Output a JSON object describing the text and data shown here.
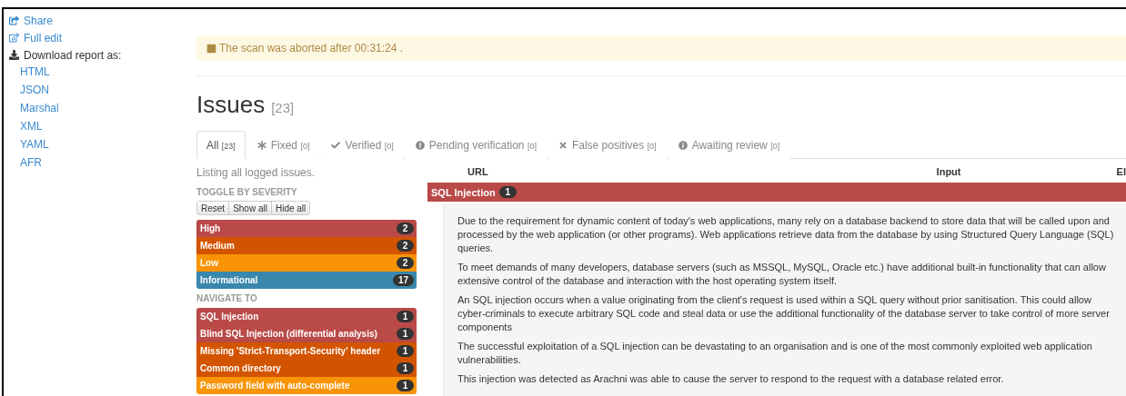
{
  "sidebar": {
    "actions": [
      {
        "label": "Share",
        "kind": "link"
      },
      {
        "label": "Full edit",
        "kind": "link"
      },
      {
        "label": "Download report as:",
        "kind": "label"
      }
    ],
    "formats": [
      "HTML",
      "JSON",
      "Marshal",
      "XML",
      "YAML",
      "AFR"
    ]
  },
  "alert": {
    "text": "The scan was aborted after 00:31:24 ."
  },
  "title": {
    "text": "Issues",
    "count": "[23]"
  },
  "tabs": [
    {
      "label": "All",
      "count": "[23]",
      "selected": true
    },
    {
      "label": "Fixed",
      "count": "[0]",
      "selected": false
    },
    {
      "label": "Verified",
      "count": "[0]",
      "selected": false
    },
    {
      "label": "Pending verification",
      "count": "[0]",
      "selected": false
    },
    {
      "label": "False positives",
      "count": "[0]",
      "selected": false
    },
    {
      "label": "Awaiting review",
      "count": "[0]",
      "selected": false
    }
  ],
  "summary": "Listing all logged issues.",
  "severity_filter": {
    "heading": "TOGGLE BY SEVERITY",
    "buttons": [
      "Reset",
      "Show all",
      "Hide all"
    ],
    "items": [
      {
        "label": "High",
        "count": "2",
        "color": "#b94a48"
      },
      {
        "label": "Medium",
        "count": "2",
        "color": "#d35400"
      },
      {
        "label": "Low",
        "count": "2",
        "color": "#f89406"
      },
      {
        "label": "Informational",
        "count": "17",
        "color": "#3a87ad"
      }
    ]
  },
  "navigate": {
    "heading": "NAVIGATE TO",
    "items": [
      {
        "label": "SQL Injection",
        "count": "1",
        "color": "#b94a48"
      },
      {
        "label": "Blind SQL Injection (differential analysis)",
        "count": "1",
        "color": "#b94a48"
      },
      {
        "label": "Missing 'Strict-Transport-Security' header",
        "count": "1",
        "color": "#d35400"
      },
      {
        "label": "Common directory",
        "count": "1",
        "color": "#d35400"
      },
      {
        "label": "Password field with auto-complete",
        "count": "1",
        "color": "#f89406"
      }
    ]
  },
  "table": {
    "columns": [
      "URL",
      "Input",
      "El"
    ]
  },
  "issue_group": {
    "title": "SQL Injection",
    "count": "1",
    "color": "#b94a48",
    "description": [
      "Due to the requirement for dynamic content of today's web applications, many rely on a database backend to store data that will be called upon and processed by the web application (or other programs). Web applications retrieve data from the database by using Structured Query Language (SQL) queries.",
      "To meet demands of many developers, database servers (such as MSSQL, MySQL, Oracle etc.) have additional built-in functionality that can allow extensive control of the database and interaction with the host operating system itself.",
      "An SQL injection occurs when a value originating from the client's request is used within a SQL query without prior sanitisation. This could allow cyber-criminals to execute arbitrary SQL code and steal data or use the additional functionality of the database server to take control of more server components",
      "The successful exploitation of a SQL injection can be devastating to an organisation and is one of the most commonly exploited web application vulnerabilities.",
      "This injection was detected as Arachni was able to cause the server to respond to the request with a database related error."
    ]
  }
}
